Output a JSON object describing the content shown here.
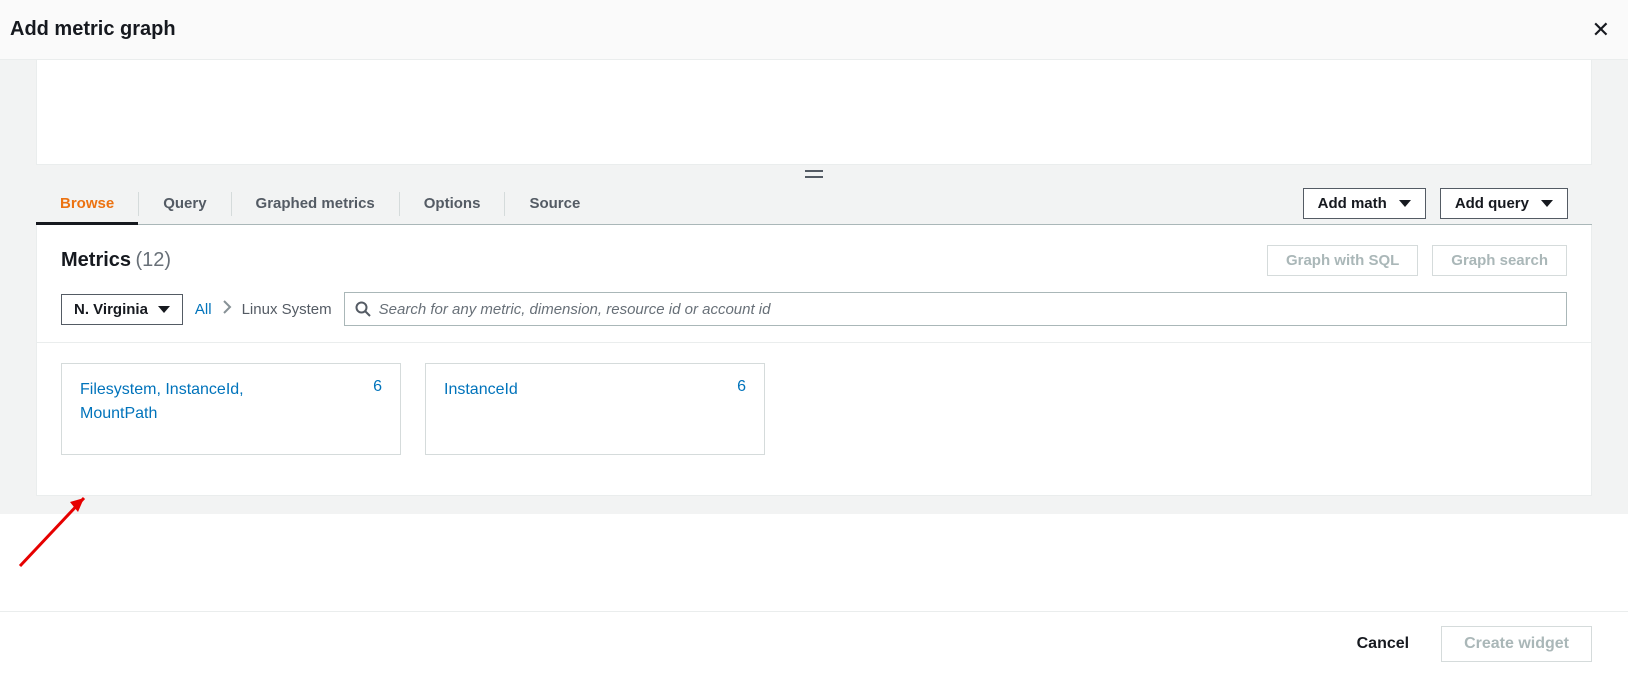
{
  "dialog": {
    "title": "Add metric graph"
  },
  "tabs": {
    "browse": "Browse",
    "query": "Query",
    "graphed": "Graphed metrics",
    "options": "Options",
    "source": "Source"
  },
  "actionButtons": {
    "addMath": "Add math",
    "addQuery": "Add query"
  },
  "metrics": {
    "heading": "Metrics",
    "count": "(12)",
    "graphSql": "Graph with SQL",
    "graphSearch": "Graph search"
  },
  "region": {
    "label": "N. Virginia"
  },
  "breadcrumb": {
    "all": "All",
    "current": "Linux System"
  },
  "search": {
    "placeholder": "Search for any metric, dimension, resource id or account id"
  },
  "cards": [
    {
      "title": "Filesystem, InstanceId, MountPath",
      "count": "6"
    },
    {
      "title": "InstanceId",
      "count": "6"
    }
  ],
  "footer": {
    "cancel": "Cancel",
    "create": "Create widget"
  }
}
